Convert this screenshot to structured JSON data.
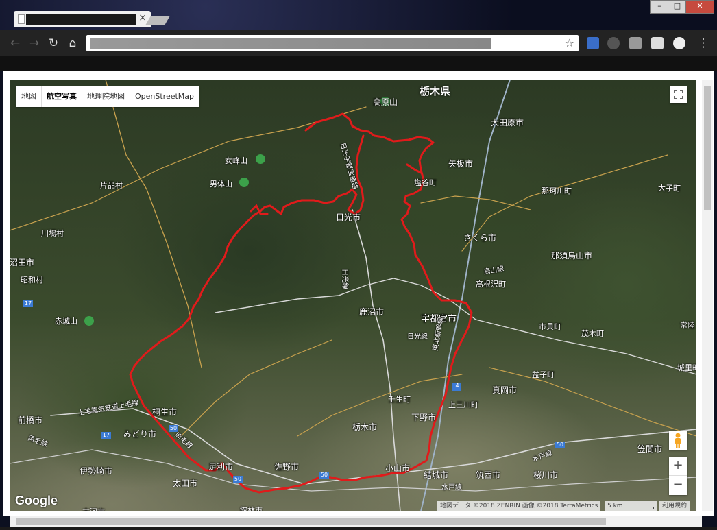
{
  "browser": {
    "tab_close": "×",
    "window_buttons": [
      "–",
      "□",
      "✕"
    ],
    "nav_icons": [
      "back-icon",
      "forward-icon",
      "reload-icon",
      "home-icon"
    ],
    "bookmark_star": "☆"
  },
  "map": {
    "type_buttons": [
      {
        "label": "地図",
        "active": false
      },
      {
        "label": "航空写真",
        "active": true
      },
      {
        "label": "地理院地図",
        "active": false
      },
      {
        "label": "OpenStreetMap",
        "active": false
      }
    ],
    "region_label": "栃木県",
    "places": [
      {
        "label": "高原山"
      },
      {
        "label": "大田原市"
      },
      {
        "label": "女峰山"
      },
      {
        "label": "矢板市"
      },
      {
        "label": "男体山"
      },
      {
        "label": "塩谷町"
      },
      {
        "label": "片品村"
      },
      {
        "label": "那珂川町"
      },
      {
        "label": "大子町"
      },
      {
        "label": "日光市"
      },
      {
        "label": "川場村"
      },
      {
        "label": "さくら市"
      },
      {
        "label": "沼田市"
      },
      {
        "label": "那須烏山市"
      },
      {
        "label": "昭和村"
      },
      {
        "label": "高根沢町"
      },
      {
        "label": "鹿沼市"
      },
      {
        "label": "宇都宮市"
      },
      {
        "label": "赤城山"
      },
      {
        "label": "市貝町"
      },
      {
        "label": "茂木町"
      },
      {
        "label": "常陸"
      },
      {
        "label": "城里町"
      },
      {
        "label": "益子町"
      },
      {
        "label": "真岡市"
      },
      {
        "label": "壬生町"
      },
      {
        "label": "上三川町"
      },
      {
        "label": "桐生市"
      },
      {
        "label": "前橋市"
      },
      {
        "label": "下野市"
      },
      {
        "label": "みどり市"
      },
      {
        "label": "栃木市"
      },
      {
        "label": "笠間市"
      },
      {
        "label": "伊勢崎市"
      },
      {
        "label": "足利市"
      },
      {
        "label": "佐野市"
      },
      {
        "label": "小山市"
      },
      {
        "label": "結城市"
      },
      {
        "label": "筑西市"
      },
      {
        "label": "桜川市"
      },
      {
        "label": "太田市"
      },
      {
        "label": "館林市"
      },
      {
        "label": "古河市"
      }
    ],
    "roads": [
      {
        "label": "日光宇都宮道路"
      },
      {
        "label": "日光線"
      },
      {
        "label": "日光線"
      },
      {
        "label": "東北新幹線"
      },
      {
        "label": "烏山線"
      },
      {
        "label": "上毛電気鉄道上毛線"
      },
      {
        "label": "両毛線"
      },
      {
        "label": "両毛線"
      },
      {
        "label": "水戸線"
      },
      {
        "label": "水戸線"
      }
    ],
    "route_shields": [
      "17",
      "17",
      "50",
      "50",
      "50",
      "50",
      "4"
    ],
    "fullscreen_icon": "fullscreen-icon",
    "zoom_in": "+",
    "zoom_out": "−",
    "google_logo": "Google",
    "attribution": "地図データ ©2018 ZENRIN 画像 ©2018 TerraMetrics",
    "scale_label": "5 km",
    "terms": "利用規約",
    "route_color": "#e01b1b"
  }
}
